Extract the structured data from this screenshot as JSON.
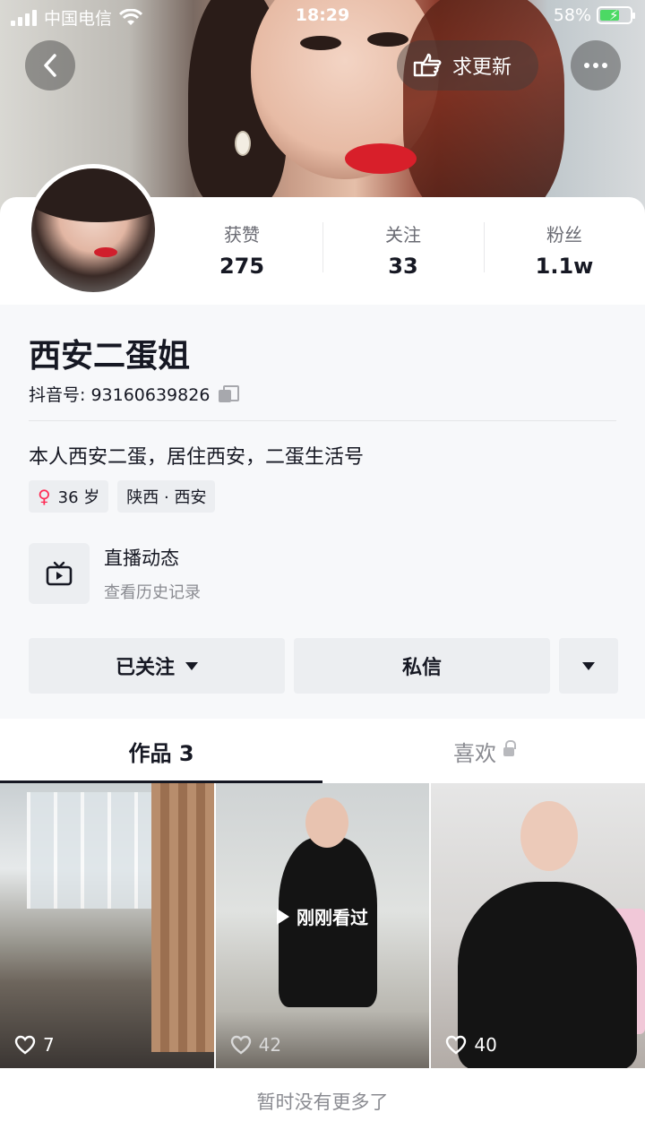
{
  "status_bar": {
    "carrier": "中国电信",
    "time": "18:29",
    "battery": "58%"
  },
  "header": {
    "request_update_label": "求更新"
  },
  "profile": {
    "name": "西安二蛋姐",
    "douyin_id": "抖音号: 93160639826",
    "bio": "本人西安二蛋，居住西安，二蛋生活号",
    "age_tag": "36 岁",
    "location_tag": "陕西 · 西安"
  },
  "stats": [
    {
      "label": "获赞",
      "value": "275"
    },
    {
      "label": "关注",
      "value": "33"
    },
    {
      "label": "粉丝",
      "value": "1.1w"
    }
  ],
  "live": {
    "title": "直播动态",
    "subtitle": "查看历史记录"
  },
  "actions": {
    "following_label": "已关注",
    "message_label": "私信"
  },
  "tabs": {
    "works_label": "作品 3",
    "likes_label": "喜欢"
  },
  "videos": [
    {
      "likes": "7"
    },
    {
      "likes": "42",
      "badge": "刚刚看过"
    },
    {
      "likes": "40"
    }
  ],
  "footer": {
    "text": "暂时没有更多了"
  },
  "colors": {
    "accent": "#fe2c55",
    "text": "#161823",
    "muted": "#8a8b91",
    "button_bg": "#eceef1"
  }
}
